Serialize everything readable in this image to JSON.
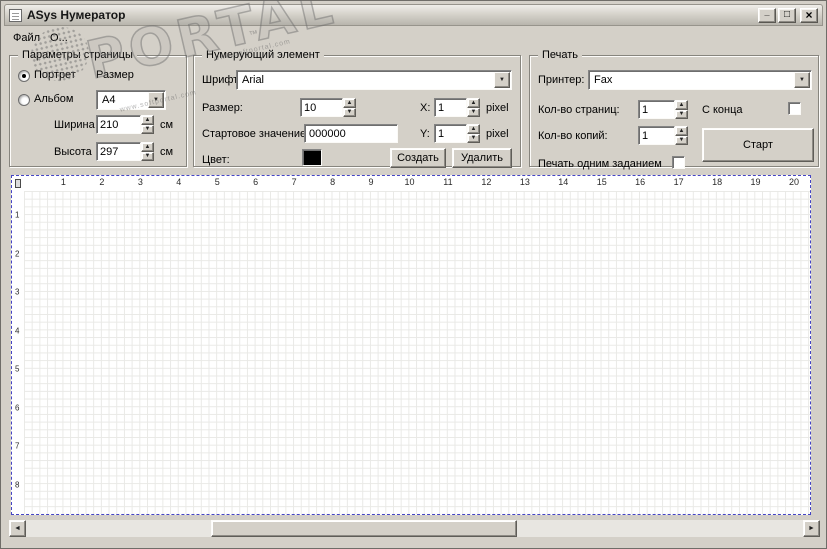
{
  "window": {
    "title": "ASys Нумератор"
  },
  "icons": {
    "minimize": "_",
    "maximize": "□",
    "close": "×",
    "dropdown": "▼",
    "spin_up": "▲",
    "spin_down": "▼",
    "scroll_left": "◄",
    "scroll_right": "►"
  },
  "menu": {
    "file": "Файл",
    "about": "О..."
  },
  "page_params": {
    "title": "Параметры страницы",
    "portrait_label": "Портрет",
    "landscape_label": "Альбом",
    "size_label": "Размер",
    "size_value": "A4",
    "width_label": "Ширина",
    "width_value": "210",
    "width_unit": "см",
    "height_label": "Высота",
    "height_value": "297",
    "height_unit": "см"
  },
  "numbering": {
    "title": "Нумерующий элемент",
    "font_label": "Шрифт",
    "font_value": "Arial",
    "size_label": "Размер:",
    "size_value": "10",
    "start_label": "Стартовое значение:",
    "start_value": "000000",
    "x_label": "X:",
    "x_value": "1",
    "y_label": "Y:",
    "y_value": "1",
    "unit": "pixel",
    "color_label": "Цвет:",
    "color_value": "#000000",
    "create_label": "Создать",
    "delete_label": "Удалить"
  },
  "print": {
    "title": "Печать",
    "printer_label": "Принтер:",
    "printer_value": "Fax",
    "pages_label": "Кол-во страниц:",
    "pages_value": "1",
    "from_end_label": "С конца",
    "copies_label": "Кол-во копий:",
    "copies_value": "1",
    "single_job_label": "Печать одним заданием",
    "start_label": "Старт"
  },
  "ruler": {
    "h": [
      "1",
      "2",
      "3",
      "4",
      "5",
      "6",
      "7",
      "8",
      "9",
      "10",
      "11",
      "12",
      "13",
      "14",
      "15",
      "16",
      "17",
      "18",
      "19",
      "20"
    ],
    "v": [
      "1",
      "2",
      "3",
      "4",
      "5",
      "6",
      "7",
      "8"
    ]
  },
  "colors": {
    "window_bg": "#d4d0c8",
    "selection_dash": "#4444c4"
  },
  "watermark": {
    "text": "PORTAL",
    "tm": "™",
    "url": "www.softportal.com"
  }
}
